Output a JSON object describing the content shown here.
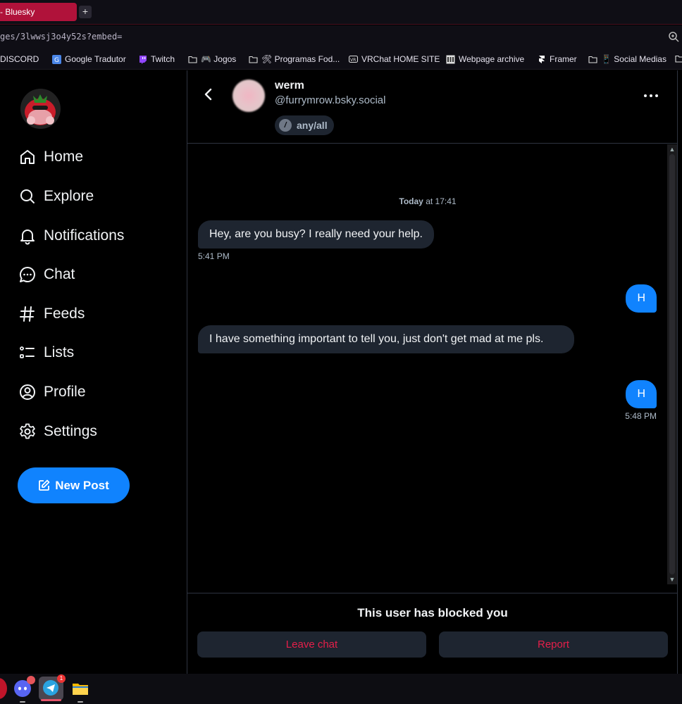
{
  "browser": {
    "tab_title": "- Bluesky",
    "new_tab_label": "+",
    "url": "ges/3lwwsj3o4y52s?embed=",
    "bookmarks": [
      {
        "label": "DISCORD",
        "icon": "folder-icon"
      },
      {
        "label": "Google Tradutor",
        "icon": "translate-icon"
      },
      {
        "label": "Twitch",
        "icon": "twitch-icon"
      },
      {
        "label": "🎮 Jogos",
        "icon": "folder-icon"
      },
      {
        "label": "🛠 Programas Fod...",
        "icon": "folder-icon"
      },
      {
        "label": "VRChat HOME SITE",
        "icon": "vrchat-icon"
      },
      {
        "label": "Webpage archive",
        "icon": "archive-icon"
      },
      {
        "label": "Framer",
        "icon": "framer-icon"
      },
      {
        "label": "📱 Social Medias",
        "icon": "folder-icon"
      }
    ]
  },
  "nav": {
    "items": [
      {
        "label": "Home",
        "icon": "home-icon"
      },
      {
        "label": "Explore",
        "icon": "search-icon"
      },
      {
        "label": "Notifications",
        "icon": "bell-icon"
      },
      {
        "label": "Chat",
        "icon": "chat-icon"
      },
      {
        "label": "Feeds",
        "icon": "hash-icon"
      },
      {
        "label": "Lists",
        "icon": "list-icon"
      },
      {
        "label": "Profile",
        "icon": "profile-icon"
      },
      {
        "label": "Settings",
        "icon": "gear-icon"
      }
    ],
    "new_post_label": "New Post"
  },
  "chat": {
    "peer_name": "werm",
    "peer_handle": "@furrymrow.bsky.social",
    "label_chip": "any/all",
    "label_chip_icon": "/",
    "day_separator_bold": "Today",
    "day_separator_rest": " at 17:41",
    "messages": [
      {
        "from": "them",
        "text": "Hey, are you busy? I really need your help.",
        "time": "5:41 PM"
      },
      {
        "from": "me",
        "text": "H",
        "time": ""
      },
      {
        "from": "them",
        "text": "I have something important to tell you, just don't get mad at me pls.",
        "time": ""
      },
      {
        "from": "me",
        "text": "H",
        "time": "5:48 PM"
      }
    ],
    "blocked_text": "This user has blocked you",
    "leave_label": "Leave chat",
    "report_label": "Report"
  },
  "colors": {
    "accent": "#1083fe",
    "danger": "#e51f4a",
    "bubble_in": "#1e2530",
    "muted_text": "#aebbc9",
    "tab_active": "#b0123a"
  },
  "taskbar": {
    "apps": [
      {
        "name": "discord-app-icon",
        "badge": ""
      },
      {
        "name": "telegram-app-icon",
        "badge": "1"
      },
      {
        "name": "file-explorer-icon",
        "badge": ""
      }
    ]
  }
}
